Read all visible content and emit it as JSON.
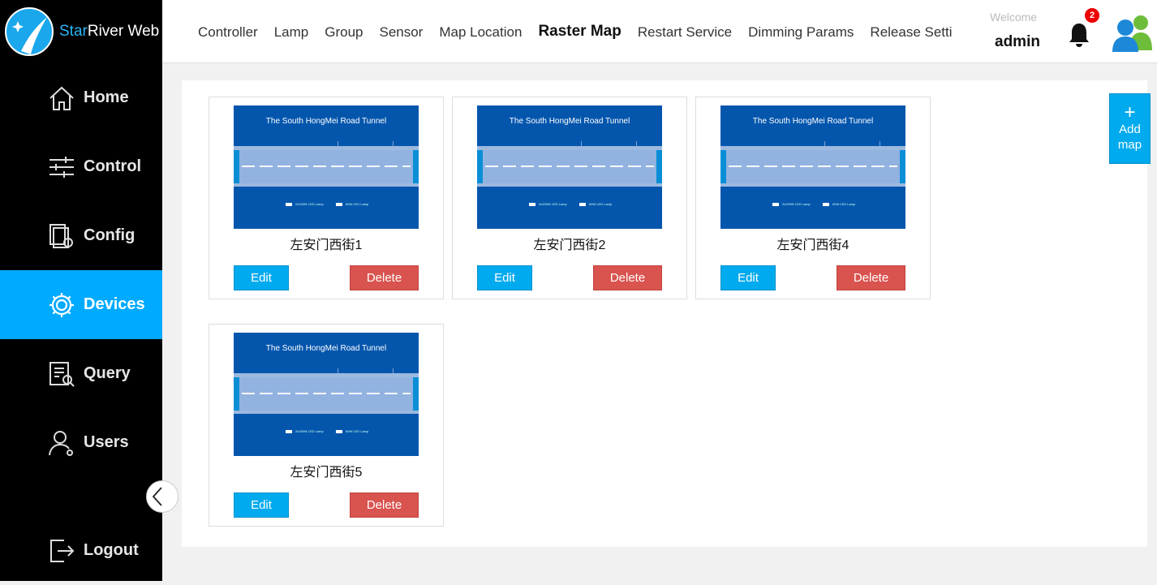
{
  "app": {
    "logo_text_accent": "Star",
    "logo_text_rest": "River Web"
  },
  "sidebar": {
    "items": [
      {
        "label": "Home",
        "icon": "home-icon",
        "active": false
      },
      {
        "label": "Control",
        "icon": "sliders-icon",
        "active": false
      },
      {
        "label": "Config",
        "icon": "config-files-icon",
        "active": false
      },
      {
        "label": "Devices",
        "icon": "gear-icon",
        "active": true
      },
      {
        "label": "Query",
        "icon": "query-document-icon",
        "active": false
      },
      {
        "label": "Users",
        "icon": "user-icon",
        "active": false
      }
    ],
    "logout_label": "Logout",
    "collapse_icon": "chevron-left-icon"
  },
  "header": {
    "tabs": [
      {
        "label": "Controller",
        "active": false
      },
      {
        "label": "Lamp",
        "active": false
      },
      {
        "label": "Group",
        "active": false
      },
      {
        "label": "Sensor",
        "active": false
      },
      {
        "label": "Map Location",
        "active": false
      },
      {
        "label": "Raster Map",
        "active": true
      },
      {
        "label": "Restart Service",
        "active": false
      },
      {
        "label": "Dimming Params",
        "active": false
      },
      {
        "label": "Release Setti",
        "active": false
      }
    ],
    "welcome": "Welcome",
    "username": "admin",
    "notification_count": "2"
  },
  "main": {
    "add_map": {
      "plus": "+",
      "line1": "Add",
      "line2": "map"
    },
    "thumbnail": {
      "title": "The South HongMei Road Tunnel",
      "legend_a": "2x200W LED Lamp",
      "legend_b": "60W LED Lamp"
    },
    "maps": [
      {
        "name": "左安门西街1",
        "edit_label": "Edit",
        "delete_label": "Delete"
      },
      {
        "name": "左安门西街2",
        "edit_label": "Edit",
        "delete_label": "Delete"
      },
      {
        "name": "左安门西街4",
        "edit_label": "Edit",
        "delete_label": "Delete"
      },
      {
        "name": "左安门西街5",
        "edit_label": "Edit",
        "delete_label": "Delete"
      }
    ]
  },
  "colors": {
    "sidebar_bg": "#000000",
    "accent": "#00aaff",
    "delete": "#d9534f",
    "thumbnail_bg": "#0456ad"
  }
}
